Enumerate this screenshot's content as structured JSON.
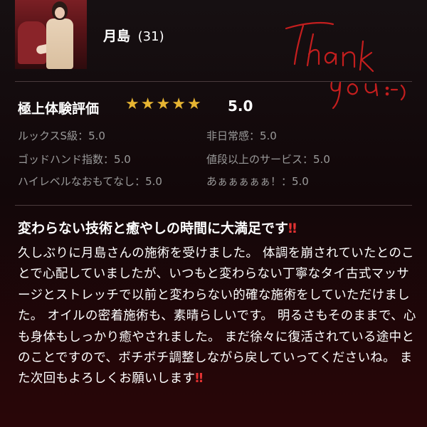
{
  "profile": {
    "name": "月島",
    "age": "(31)"
  },
  "rating": {
    "title": "極上体験評価",
    "stars": 5,
    "score": "5.0",
    "star_color": "#e6b432",
    "metrics": [
      {
        "label": "ルックスS級：5.0"
      },
      {
        "label": "非日常感：5.0"
      },
      {
        "label": "ゴッドハンド指数：5.0"
      },
      {
        "label": "値段以上のサービス：5.0"
      },
      {
        "label": "ハイレベルなおもてなし：5.0"
      },
      {
        "label": "あぁぁぁぁぁ！：5.0"
      }
    ]
  },
  "review": {
    "title": "変わらない技術と癒やしの時間に大満足です",
    "title_mark": "‼",
    "body": "久しぶりに月島さんの施術を受けました。 体調を崩されていたとのことで心配していましたが、いつもと変わらない丁寧なタイ古式マッサージとストレッチで以前と変わらない的確な施術をしていただけました。 オイルの密着施術も、素晴らしいです。 明るさもそのままで、心も身体もしっかり癒やされました。 まだ徐々に復活されている途中とのことですので、ボチボチ調整しながら戻していってくださいね。 また次回もよろしくお願いします",
    "body_mark": "‼"
  },
  "decoration": {
    "thank_you_text": "Thank you:-)",
    "accent_color": "#c41e1e"
  }
}
